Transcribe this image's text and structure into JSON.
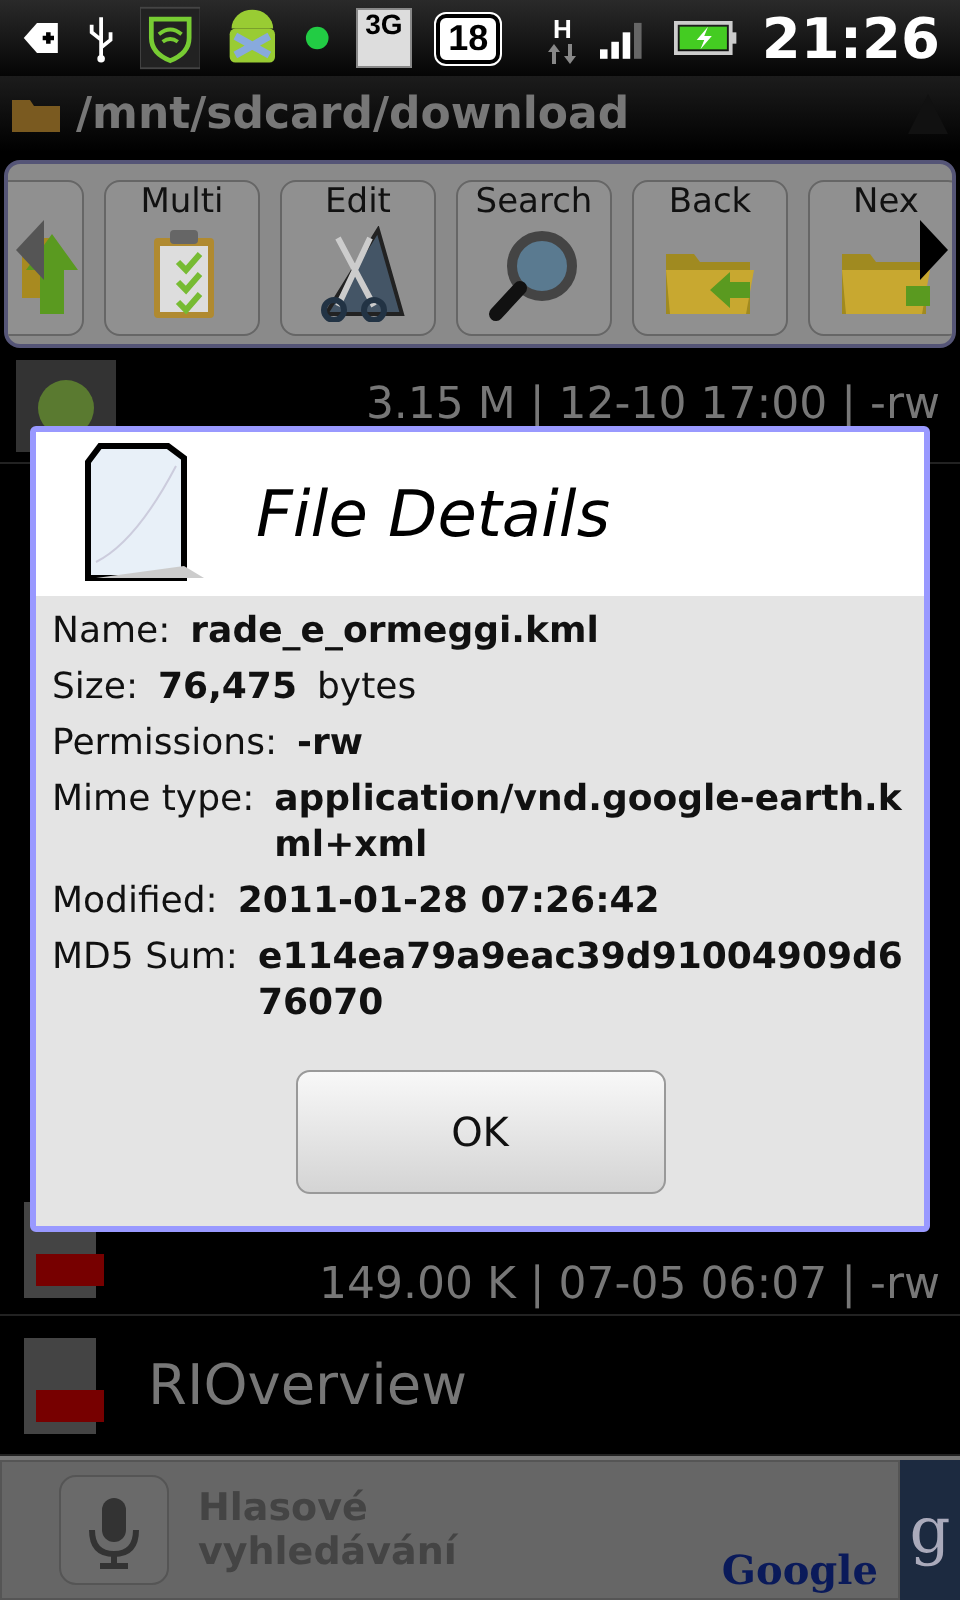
{
  "status_bar": {
    "network": "3G",
    "badge": "18",
    "data": "H",
    "time": "21:26"
  },
  "path_bar": {
    "path": "/mnt/sdcard/download"
  },
  "toolbar": {
    "buttons": [
      {
        "kind": "up"
      },
      {
        "kind": "multi",
        "label": "Multi"
      },
      {
        "kind": "edit",
        "label": "Edit"
      },
      {
        "kind": "search",
        "label": "Search"
      },
      {
        "kind": "back",
        "label": "Back"
      },
      {
        "kind": "next",
        "label": "Nex"
      }
    ]
  },
  "file_list": {
    "rows": [
      {
        "kind": "apk",
        "meta": "3.15 M | 12-10 17:00 | -rw"
      },
      {
        "kind": "pdf",
        "meta": "149.00 K | 07-05 06:07 | -rw"
      },
      {
        "kind": "pdf",
        "name": "RIOverview"
      }
    ]
  },
  "dialog": {
    "title": "File Details",
    "fields": [
      {
        "label": "Name:",
        "value": "rade_e_ormeggi.kml"
      },
      {
        "label": "Size:",
        "value": "76,475",
        "unit": "bytes"
      },
      {
        "label": "Permissions:",
        "value": "-rw"
      },
      {
        "label": "Mime type:",
        "value": "application/vnd.google-earth.kml+xml"
      },
      {
        "label": "Modified:",
        "value": "2011-01-28 07:26:42"
      },
      {
        "label": "MD5 Sum:",
        "value": "e114ea79a9eac39d91004909d676070"
      }
    ],
    "button": "OK"
  },
  "search_widget": {
    "label": "Hlasové vyhledávání",
    "logo": "Google",
    "button": "g"
  }
}
